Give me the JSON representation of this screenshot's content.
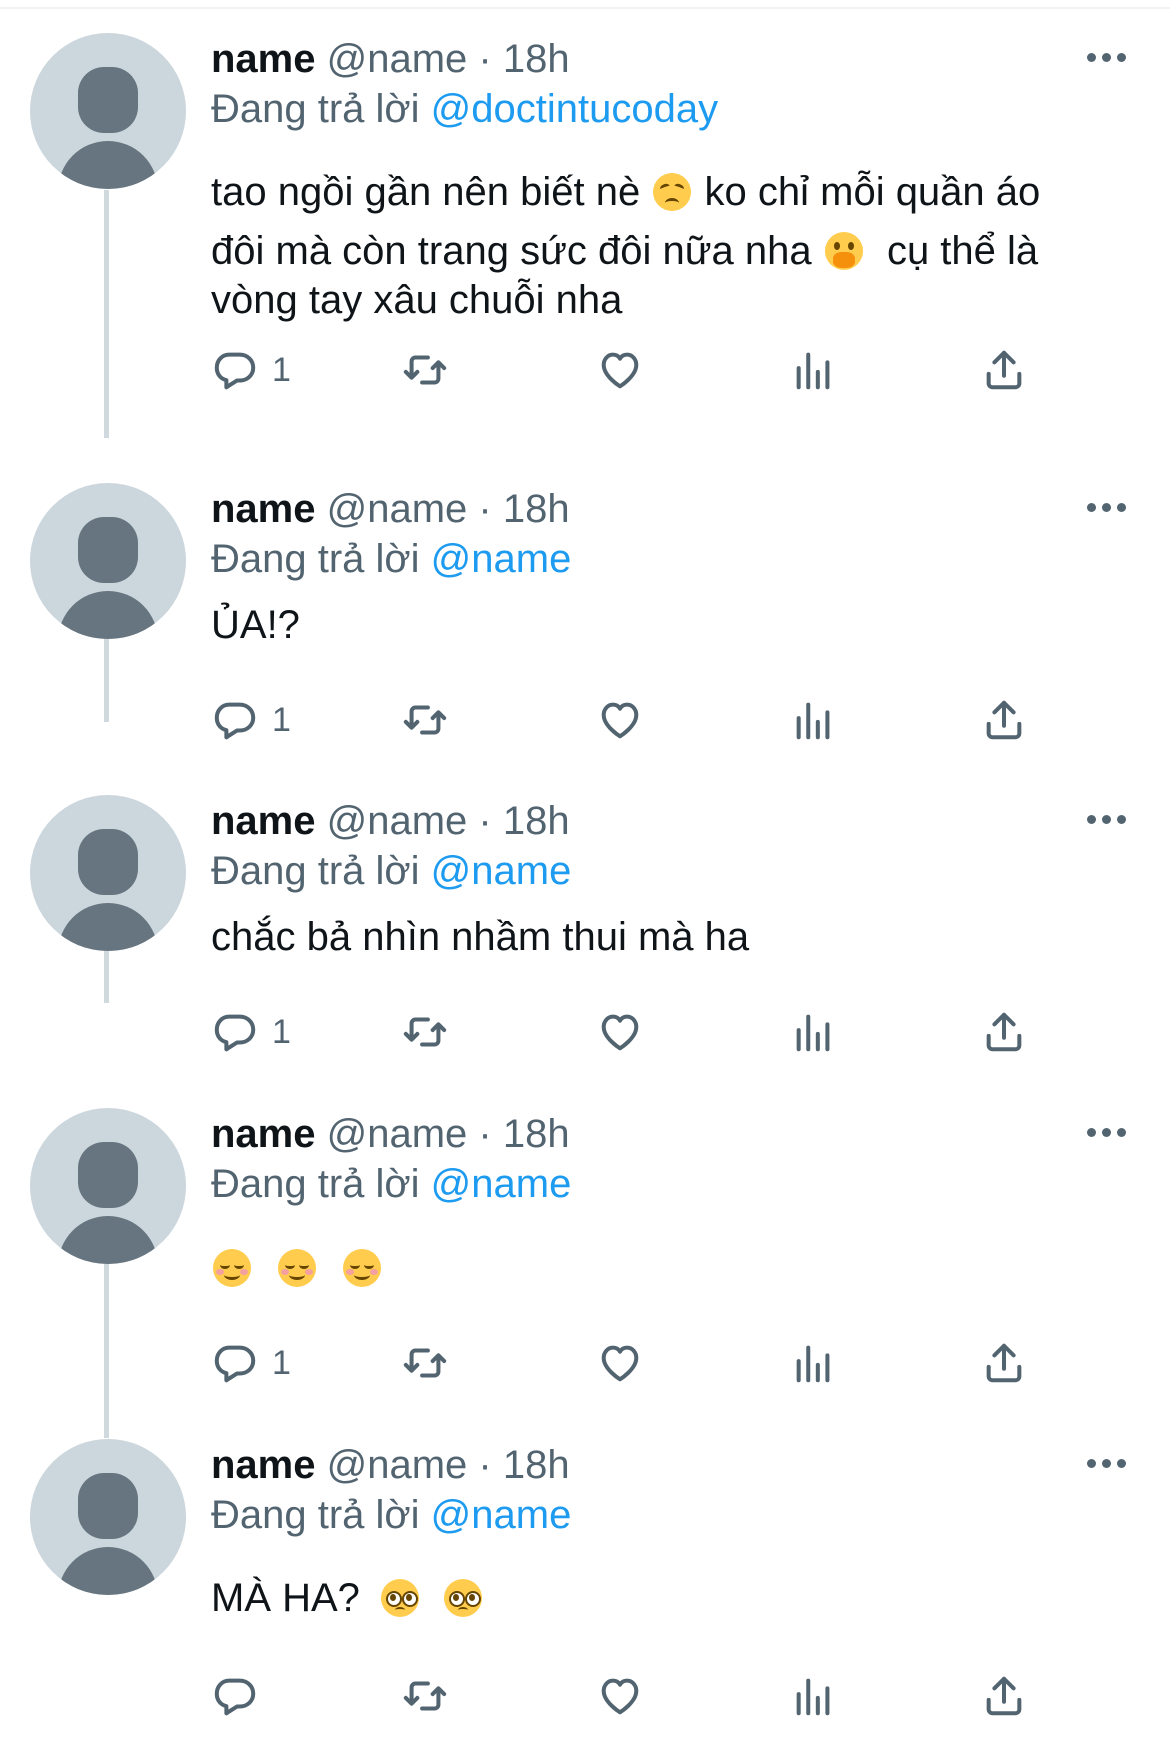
{
  "colors": {
    "link": "#1d9bf0",
    "muted": "#536471",
    "text": "#0f1419",
    "avatar_bg": "#ccd6dd",
    "avatar_fg": "#66757f",
    "thread_line": "#cfd9de"
  },
  "tweets": [
    {
      "display_name": "name",
      "handle": "@name",
      "separator": "·",
      "time": "18h",
      "reply_prefix": "Đang trả lời",
      "reply_to": "@doctintucoday",
      "lines": [
        "tao ngồi gần nên biết nè",
        "ko chỉ mỗi quần áo",
        "đôi mà còn trang sức đôi nữa nha",
        "cụ thể là",
        "vòng tay xâu chuỗi nha"
      ],
      "emojis": [
        "disappointed-face-emoji",
        "face-with-hand-over-mouth-emoji"
      ],
      "reply_count": "1"
    },
    {
      "display_name": "name",
      "handle": "@name",
      "separator": "·",
      "time": "18h",
      "reply_prefix": "Đang trả lời",
      "reply_to": "@name",
      "text": "ỦA!?",
      "reply_count": "1"
    },
    {
      "display_name": "name",
      "handle": "@name",
      "separator": "·",
      "time": "18h",
      "reply_prefix": "Đang trả lời",
      "reply_to": "@name",
      "text": "chắc bả nhìn nhầm thui mà ha",
      "reply_count": "1"
    },
    {
      "display_name": "name",
      "handle": "@name",
      "separator": "·",
      "time": "18h",
      "reply_prefix": "Đang trả lời",
      "reply_to": "@name",
      "text": "",
      "emojis": [
        "smiling-face-emoji",
        "smiling-face-emoji",
        "smiling-face-emoji"
      ],
      "reply_count": "1"
    },
    {
      "display_name": "name",
      "handle": "@name",
      "separator": "·",
      "time": "18h",
      "reply_prefix": "Đang trả lời",
      "reply_to": "@name",
      "text": "MÀ HA?",
      "emojis": [
        "pleading-face-emoji",
        "pleading-face-emoji"
      ],
      "reply_count": ""
    }
  ],
  "action_icons": [
    "reply-icon",
    "retweet-icon",
    "like-icon",
    "views-icon",
    "share-icon"
  ]
}
